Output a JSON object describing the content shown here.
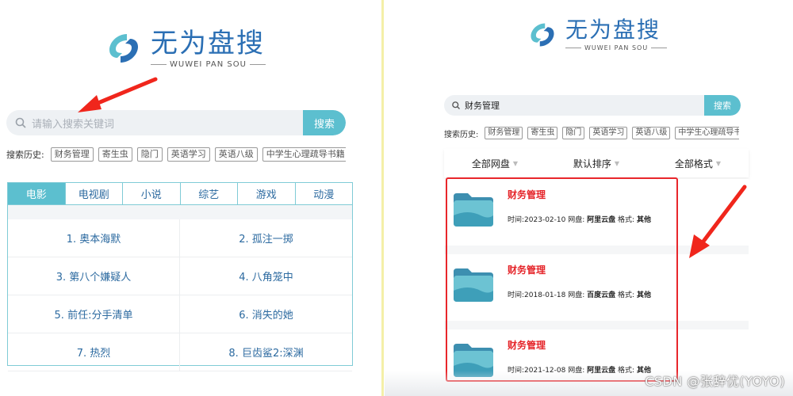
{
  "left": {
    "logo": {
      "title": "无为盘搜",
      "subtitle": "WUWEI PAN SOU"
    },
    "search": {
      "placeholder": "请输入搜索关键词",
      "button": "搜索"
    },
    "history": {
      "label": "搜索历史:",
      "tags": [
        "财务管理",
        "寄生虫",
        "隐门",
        "英语学习",
        "英语八级",
        "中学生心理疏导书籍"
      ]
    },
    "tabs": [
      {
        "label": "电影",
        "active": true
      },
      {
        "label": "电视剧",
        "active": false
      },
      {
        "label": "小说",
        "active": false
      },
      {
        "label": "综艺",
        "active": false
      },
      {
        "label": "游戏",
        "active": false
      },
      {
        "label": "动漫",
        "active": false
      }
    ],
    "movies": [
      "1. 奥本海默",
      "2. 孤注一掷",
      "3. 第八个嫌疑人",
      "4. 八角笼中",
      "5. 前任:分手清单",
      "6. 消失的她",
      "7. 热烈",
      "8. 巨齿鲨2:深渊"
    ]
  },
  "right": {
    "logo": {
      "title": "无为盘搜",
      "subtitle": "WUWEI PAN SOU"
    },
    "search": {
      "value": "财务管理",
      "button": "搜索"
    },
    "history": {
      "label": "搜索历史:",
      "tags": [
        "财务管理",
        "寄生虫",
        "隐门",
        "英语学习",
        "英语八级",
        "中学生心理疏导书籍"
      ]
    },
    "filters": [
      "全部网盘",
      "默认排序",
      "全部格式"
    ],
    "results": [
      {
        "name": "财务管理",
        "time_label": "时间:",
        "time": "2023-02-10",
        "disk_label": "网盘:",
        "disk": "阿里云盘",
        "format_label": "格式:",
        "format": "其他"
      },
      {
        "name": "财务管理",
        "time_label": "时间:",
        "time": "2018-01-18",
        "disk_label": "网盘:",
        "disk": "百度云盘",
        "format_label": "格式:",
        "format": "其他"
      },
      {
        "name": "财务管理",
        "time_label": "时间:",
        "time": "2021-12-08",
        "disk_label": "网盘:",
        "disk": "阿里云盘",
        "format_label": "格式:",
        "format": "其他"
      }
    ]
  },
  "watermark": "CSDN @张辞优(YOYO)",
  "colors": {
    "accent": "#5cbfcf",
    "brand_blue": "#2b6fb4",
    "result_title": "#e5252a",
    "highlight_box": "#e8262b",
    "arrow": "#f0261c"
  }
}
